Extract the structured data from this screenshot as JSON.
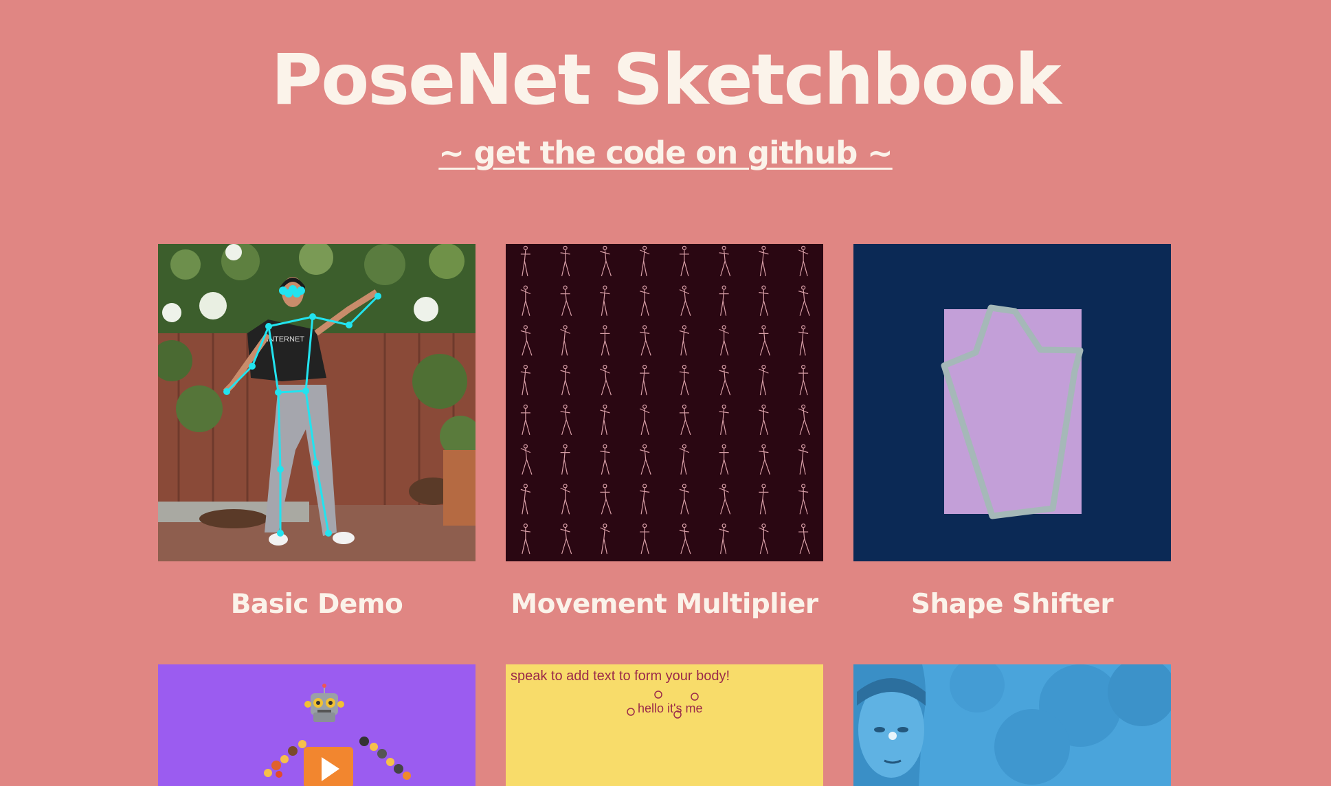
{
  "header": {
    "title": "PoseNet Sketchbook",
    "github_link": "~ get the code on github ~"
  },
  "cards": [
    {
      "label": "Basic Demo",
      "thumbnail": "person-with-pose-skeleton"
    },
    {
      "label": "Movement Multiplier",
      "thumbnail": "grid-of-dancing-skeletons"
    },
    {
      "label": "Shape Shifter",
      "thumbnail": "purple-rect-with-pose-outline"
    },
    {
      "label": "",
      "thumbnail": "robot-emoji-play-button"
    },
    {
      "label": "",
      "thumbnail": "speech-text-body",
      "speak_text": "speak to add text to form your body!",
      "hello_text": "hello it's me"
    },
    {
      "label": "",
      "thumbnail": "blue-tinted-face"
    }
  ],
  "colors": {
    "background": "#e08683",
    "text": "#fbf3ea",
    "skeleton": "#22e3ef",
    "movement_bg": "#2a0712",
    "shape_bg": "#0b2955",
    "shape_rect": "#c39fd8",
    "robot_bg": "#9b5cf0",
    "speech_bg": "#f8dc6a",
    "face_bg": "#4aa4db"
  }
}
